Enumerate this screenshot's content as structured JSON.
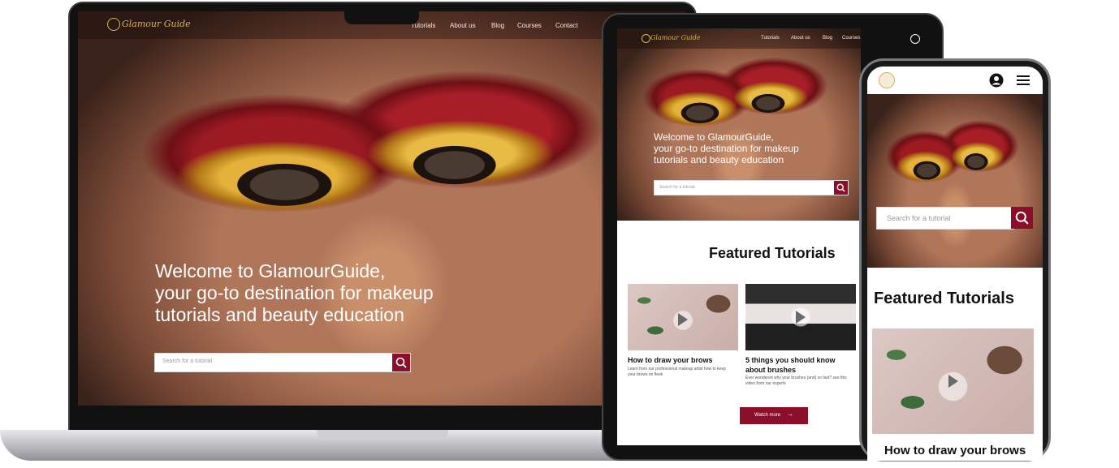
{
  "brand": {
    "name": "Glamour Guide",
    "accent": "#8b0f2a",
    "gold": "#d8b35c"
  },
  "nav": {
    "items": [
      "Tutorials",
      "About us",
      "Blog",
      "Courses",
      "Contact"
    ]
  },
  "hero": {
    "desktop_lines": [
      "Welcome to GlamourGuide,",
      "your go-to destination for makeup",
      "tutorials and beauty education"
    ],
    "tablet_lines": [
      "Welcome to GlamourGuide,",
      "your go-to destination for makeup",
      "tutorials and beauty education"
    ]
  },
  "search": {
    "placeholder": "Search for a tutorial",
    "phone_placeholder": "Search for a  tutorial"
  },
  "featured": {
    "title": "Featured Tutorials",
    "cards": [
      {
        "title": "How to draw your brows",
        "desc": "Learn from our professional makeup artist how to keep your brows on fleek"
      },
      {
        "title": "5 things you should know about brushes",
        "desc": "Ever wondered why your brushes (and) so fast? see this video from our experts"
      }
    ],
    "watch_more": "Watch more",
    "phone_card_title": "How to draw your brows"
  },
  "icons": {
    "search": "search-icon",
    "globe": "globe-icon",
    "user": "user-icon",
    "menu": "menu-icon",
    "play": "play-icon",
    "arrow": "arrow-right-icon"
  }
}
